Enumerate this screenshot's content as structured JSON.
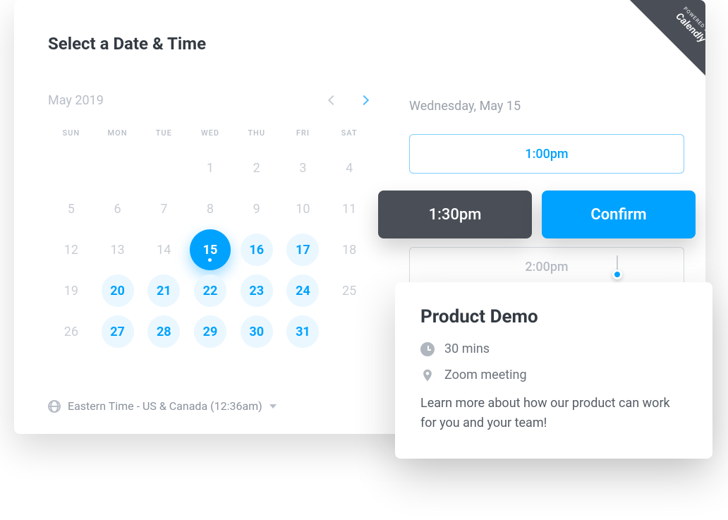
{
  "ribbon": {
    "small": "POWERED BY",
    "brand": "Calendly"
  },
  "title": "Select a Date & Time",
  "calendar": {
    "month_label": "May 2019",
    "dow": [
      "SUN",
      "MON",
      "TUE",
      "WED",
      "THU",
      "FRI",
      "SAT"
    ],
    "weeks": [
      [
        {
          "n": ""
        },
        {
          "n": ""
        },
        {
          "n": ""
        },
        {
          "n": "1"
        },
        {
          "n": "2"
        },
        {
          "n": "3"
        },
        {
          "n": "4"
        }
      ],
      [
        {
          "n": "5"
        },
        {
          "n": "6"
        },
        {
          "n": "7"
        },
        {
          "n": "8"
        },
        {
          "n": "9"
        },
        {
          "n": "10"
        },
        {
          "n": "11"
        }
      ],
      [
        {
          "n": "12"
        },
        {
          "n": "13"
        },
        {
          "n": "14"
        },
        {
          "n": "15",
          "selected": true
        },
        {
          "n": "16",
          "avail": true
        },
        {
          "n": "17",
          "avail": true
        },
        {
          "n": "18"
        }
      ],
      [
        {
          "n": "19"
        },
        {
          "n": "20",
          "avail": true
        },
        {
          "n": "21",
          "avail": true
        },
        {
          "n": "22",
          "avail": true
        },
        {
          "n": "23",
          "avail": true
        },
        {
          "n": "24",
          "avail": true
        },
        {
          "n": "25"
        }
      ],
      [
        {
          "n": "26"
        },
        {
          "n": "27",
          "avail": true
        },
        {
          "n": "28",
          "avail": true
        },
        {
          "n": "29",
          "avail": true
        },
        {
          "n": "30",
          "avail": true
        },
        {
          "n": "31",
          "avail": true
        },
        {
          "n": ""
        }
      ]
    ]
  },
  "timezone": "Eastern Time - US & Canada (12:36am)",
  "selected_date": "Wednesday, May 15",
  "slots": {
    "s1": "1:00pm",
    "s2": "1:30pm",
    "s3": "2:00pm"
  },
  "confirm_label": "Confirm",
  "popover": {
    "title": "Product Demo",
    "duration": "30 mins",
    "location": "Zoom meeting",
    "description": "Learn more about how our product can work for you and your team!"
  }
}
